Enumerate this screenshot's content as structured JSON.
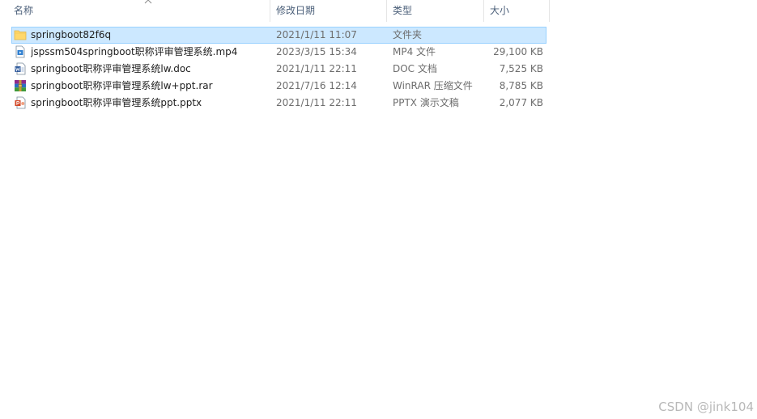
{
  "columns": {
    "name": "名称",
    "date": "修改日期",
    "type": "类型",
    "size": "大小"
  },
  "files": [
    {
      "name": "springboot82f6q",
      "date": "2021/1/11 11:07",
      "type": "文件夹",
      "size": "",
      "icon": "folder-icon"
    },
    {
      "name": "jspssm504springboot职称评审管理系统.mp4",
      "date": "2023/3/15 15:34",
      "type": "MP4 文件",
      "size": "29,100 KB",
      "icon": "video-file-icon"
    },
    {
      "name": "springboot职称评审管理系统lw.doc",
      "date": "2021/1/11 22:11",
      "type": "DOC 文档",
      "size": "7,525 KB",
      "icon": "word-document-icon"
    },
    {
      "name": "springboot职称评审管理系统lw+ppt.rar",
      "date": "2021/7/16 12:14",
      "type": "WinRAR 压缩文件",
      "size": "8,785 KB",
      "icon": "winrar-archive-icon"
    },
    {
      "name": "springboot职称评审管理系统ppt.pptx",
      "date": "2021/1/11 22:11",
      "type": "PPTX 演示文稿",
      "size": "2,077 KB",
      "icon": "powerpoint-file-icon"
    }
  ],
  "watermark": "CSDN @jink104",
  "colors": {
    "selection_fill": "#cce8ff",
    "selection_border": "#99d1ff",
    "header_text": "#4c607a",
    "folder": "#ffd86a"
  }
}
